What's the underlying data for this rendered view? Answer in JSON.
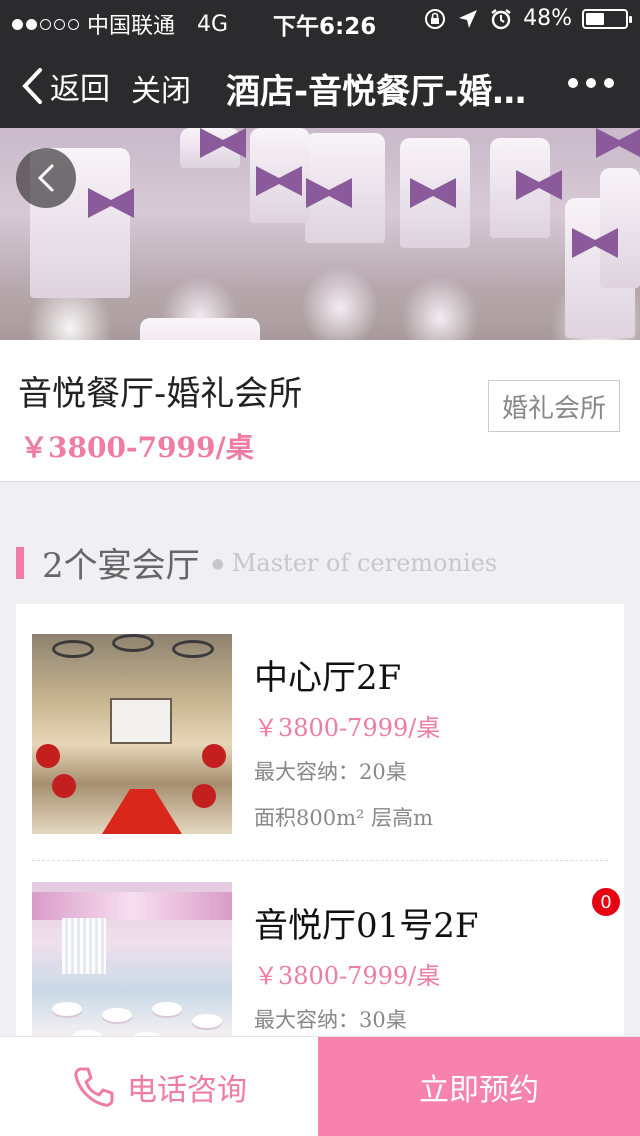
{
  "status_bar": {
    "carrier": "中国联通",
    "network": "4G",
    "time": "下午6:26",
    "battery": "48%",
    "battery_level": 0.48
  },
  "nav": {
    "back_label": "返回",
    "close_label": "关闭",
    "title": "酒店-音悦餐厅-婚礼会所"
  },
  "venue": {
    "name": "音悦餐厅-婚礼会所",
    "price": "￥3800-7999/桌",
    "tag": "婚礼会所"
  },
  "section": {
    "title": "2个宴会厅",
    "subtitle": "Master of ceremonies"
  },
  "halls": [
    {
      "name": "中心厅2F",
      "price": "￥3800-7999/桌",
      "capacity": "最大容纳：20桌",
      "area": "面积800m² 层高m"
    },
    {
      "name": "音悦厅01号2F",
      "price": "￥3800-7999/桌",
      "capacity": "最大容纳：30桌",
      "badge": "0"
    }
  ],
  "bottom_bar": {
    "call_label": "电话咨询",
    "book_label": "立即预约"
  },
  "colors": {
    "accent": "#f07ba3",
    "book_button": "#f783ac",
    "header_bg": "#2b2b2d",
    "badge": "#e60012"
  },
  "icons": [
    "back-icon",
    "more-icon",
    "carousel-back-icon",
    "phone-icon",
    "lock-rotation-icon",
    "location-icon",
    "alarm-icon",
    "battery-icon"
  ]
}
